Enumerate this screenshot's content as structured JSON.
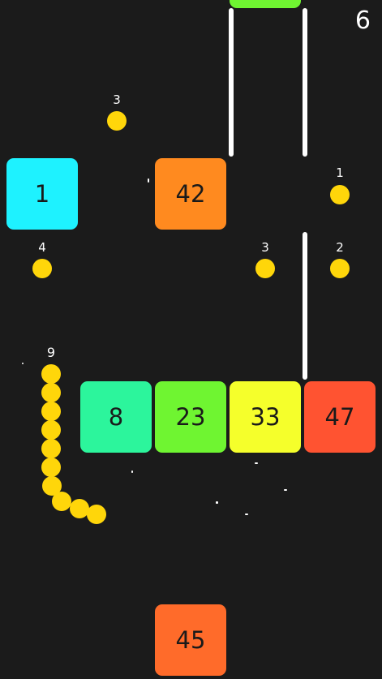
{
  "game": {
    "score": "6"
  },
  "colors": {
    "background": "#1b1b1b",
    "pellet": "#ffd60a",
    "snake": "#ffd60a",
    "wall": "#ffffff",
    "text": "#ffffff",
    "block_text": "#1a1a1a"
  },
  "blocks": [
    {
      "value": "1",
      "color": "#1ef2ff",
      "icon": "number-block"
    },
    {
      "value": "42",
      "color": "#ff8a1f",
      "icon": "number-block"
    },
    {
      "value": "8",
      "color": "#2cf59c",
      "icon": "number-block"
    },
    {
      "value": "23",
      "color": "#6ff531",
      "icon": "number-block"
    },
    {
      "value": "33",
      "color": "#f5ff2b",
      "icon": "number-block"
    },
    {
      "value": "47",
      "color": "#ff5331",
      "icon": "number-block"
    },
    {
      "value": "45",
      "color": "#ff6b2a",
      "icon": "number-block"
    },
    {
      "value": "",
      "color": "#6ff531",
      "icon": "number-block"
    }
  ],
  "pellets": [
    {
      "value": "3"
    },
    {
      "value": "1"
    },
    {
      "value": "4"
    },
    {
      "value": "3"
    },
    {
      "value": "2"
    }
  ],
  "snake": {
    "length": "9",
    "segments": 10
  }
}
